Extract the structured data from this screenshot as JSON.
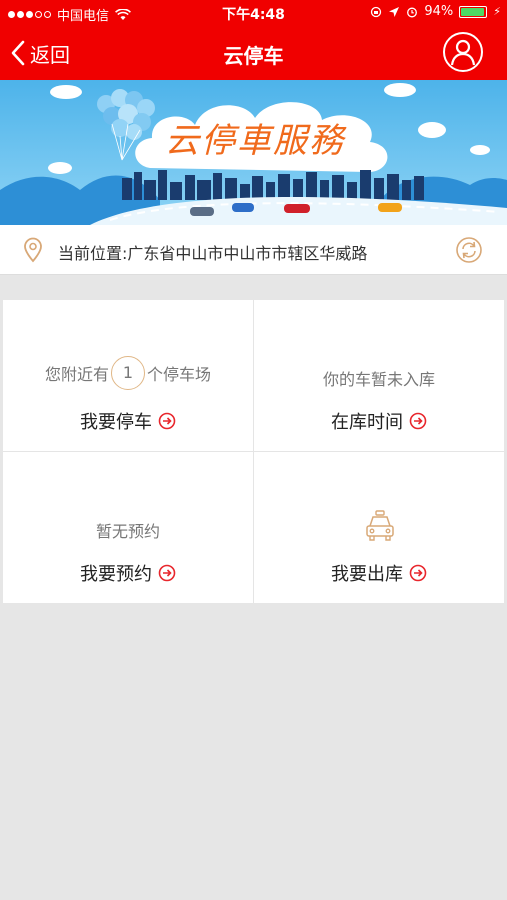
{
  "status_bar": {
    "carrier": "中国电信",
    "time": "下午4:48",
    "battery_percent_text": "94%",
    "battery_level": 0.94,
    "battery_color": "#4cd964"
  },
  "navbar": {
    "back_label": "返回",
    "title": "云停车",
    "background_color": "#f00000"
  },
  "banner": {
    "title": "云停車服務"
  },
  "location": {
    "text": "当前位置:广东省中山市中山市市辖区华威路"
  },
  "grid": {
    "park": {
      "prefix": "您附近有",
      "count": "1",
      "suffix": "个停车场",
      "action": "我要停车"
    },
    "storage": {
      "status": "你的车暂未入库",
      "action": "在库时间"
    },
    "reserve": {
      "status": "暂无预约",
      "action": "我要预约"
    },
    "exit": {
      "action": "我要出库"
    }
  },
  "colors": {
    "accent": "#e8262c",
    "badge_border": "#e0b787"
  }
}
